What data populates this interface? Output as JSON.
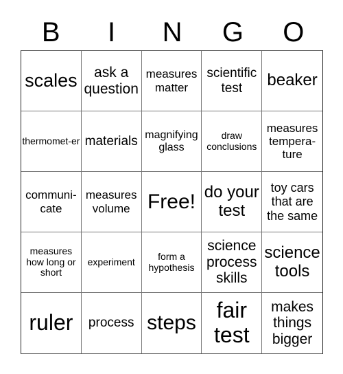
{
  "header": [
    "B",
    "I",
    "N",
    "G",
    "O"
  ],
  "cells": [
    [
      "scales",
      "ask a question",
      "measures matter",
      "scientific test",
      "beaker"
    ],
    [
      "thermomet-er",
      "materials",
      "magnifying glass",
      "draw conclusions",
      "measures tempera-ture"
    ],
    [
      "communi-cate",
      "measures volume",
      "Free!",
      "do your test",
      "toy cars that are the same"
    ],
    [
      "measures how long or short",
      "experiment",
      "form a hypothesis",
      "science process skills",
      "science tools"
    ],
    [
      "ruler",
      "process",
      "steps",
      "fair test",
      "makes things bigger"
    ]
  ]
}
